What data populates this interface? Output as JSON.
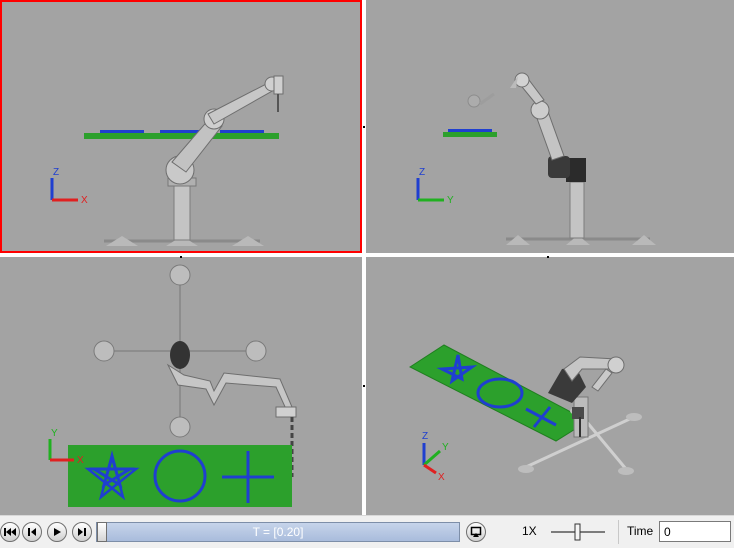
{
  "viewports": [
    {
      "id": "front",
      "axes": [
        "Z",
        "X"
      ]
    },
    {
      "id": "side",
      "axes": [
        "Z",
        "Y"
      ]
    },
    {
      "id": "top",
      "axes": [
        "Y",
        "X"
      ]
    },
    {
      "id": "iso",
      "axes": [
        "Z",
        "Y",
        "X"
      ]
    }
  ],
  "playback": {
    "buttons": [
      "go-to-start",
      "step-back",
      "play",
      "step-forward"
    ],
    "time_display": "T = [0.20]",
    "speed": "1X",
    "time_label": "Time",
    "time_value": "0"
  },
  "colors": {
    "viewport_bg": "#a3a3a3",
    "active_border": "#ff0000",
    "board": "#2ca02c",
    "drawing": "#1f3fd0",
    "axis_z": "#1f3fd0",
    "axis_x": "#e02020",
    "axis_y": "#20b020"
  },
  "board_symbols": [
    "star",
    "circle",
    "cross"
  ]
}
